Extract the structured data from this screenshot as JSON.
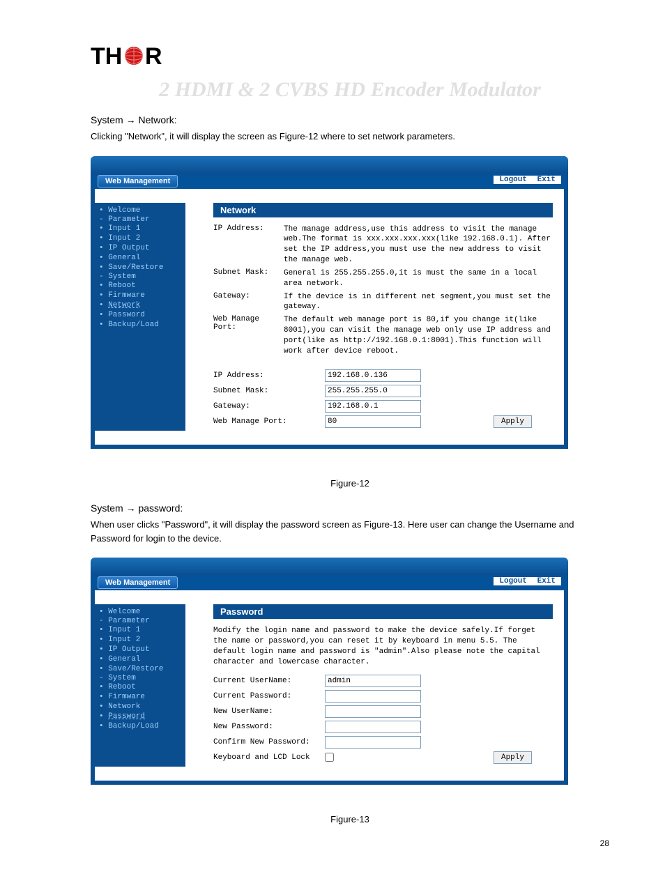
{
  "logo_text": "TH  R",
  "doc_title": "2 HDMI & 2 CVBS HD Encoder Modulator",
  "network_heading": "System → Network:",
  "network_intro": "Clicking \"Network\", it will display the screen as Figure-12 where to set network parameters.",
  "sidebar": {
    "welcome": "Welcome",
    "parameter": "Parameter",
    "input1": "Input 1",
    "input2": "Input 2",
    "ip_output": "IP Output",
    "general": "General",
    "save_restore": "Save/Restore",
    "system": "System",
    "reboot": "Reboot",
    "firmware": "Firmware",
    "network": "Network",
    "password": "Password",
    "backup_load": "Backup/Load"
  },
  "hdr": {
    "badge": "Web Management",
    "logout": "Logout",
    "exit": "Exit"
  },
  "network": {
    "title": "Network",
    "rows": {
      "ip_label": "IP Address:",
      "ip_desc": "The manage address,use this address to visit the manage web.The format is xxx.xxx.xxx.xxx(like 192.168.0.1). After set the IP address,you must use the new address to visit the manage web.",
      "mask_label": "Subnet Mask:",
      "mask_desc": "General is 255.255.255.0,it is must the same in a local area network.",
      "gw_label": "Gateway:",
      "gw_desc": "If the device is in different net segment,you must set the gateway.",
      "port_label": "Web Manage Port:",
      "port_desc": "The default web manage port is 80,if you change it(like 8001),you can visit the manage web only use IP address and port(like as http://192.168.0.1:8001).This function will work after device reboot."
    },
    "form": {
      "ip_label": "IP Address:",
      "ip_value": "192.168.0.136",
      "mask_label": "Subnet Mask:",
      "mask_value": "255.255.255.0",
      "gw_label": "Gateway:",
      "gw_value": "192.168.0.1",
      "port_label": "Web Manage Port:",
      "port_value": "80",
      "apply": "Apply"
    }
  },
  "figure12": "Figure-12",
  "password_heading": "System → password:",
  "password_intro": "When user clicks \"Password\", it will display the password screen as Figure-13. Here user can change the Username and Password for login to the device.",
  "password": {
    "title": "Password",
    "desc": "Modify the login name and password to make the device safely.If forget the name or password,you can reset it by keyboard in menu 5.5. The default login name and password is \"admin\".Also please note the capital character and lowercase character.",
    "cur_user_label": "Current UserName:",
    "cur_user_value": "admin",
    "cur_pw_label": "Current Password:",
    "new_user_label": "New UserName:",
    "new_pw_label": "New Password:",
    "confirm_pw_label": "Confirm New Password:",
    "lock_label": "Keyboard and LCD Lock",
    "apply": "Apply"
  },
  "figure13": "Figure-13",
  "page_number": "28"
}
